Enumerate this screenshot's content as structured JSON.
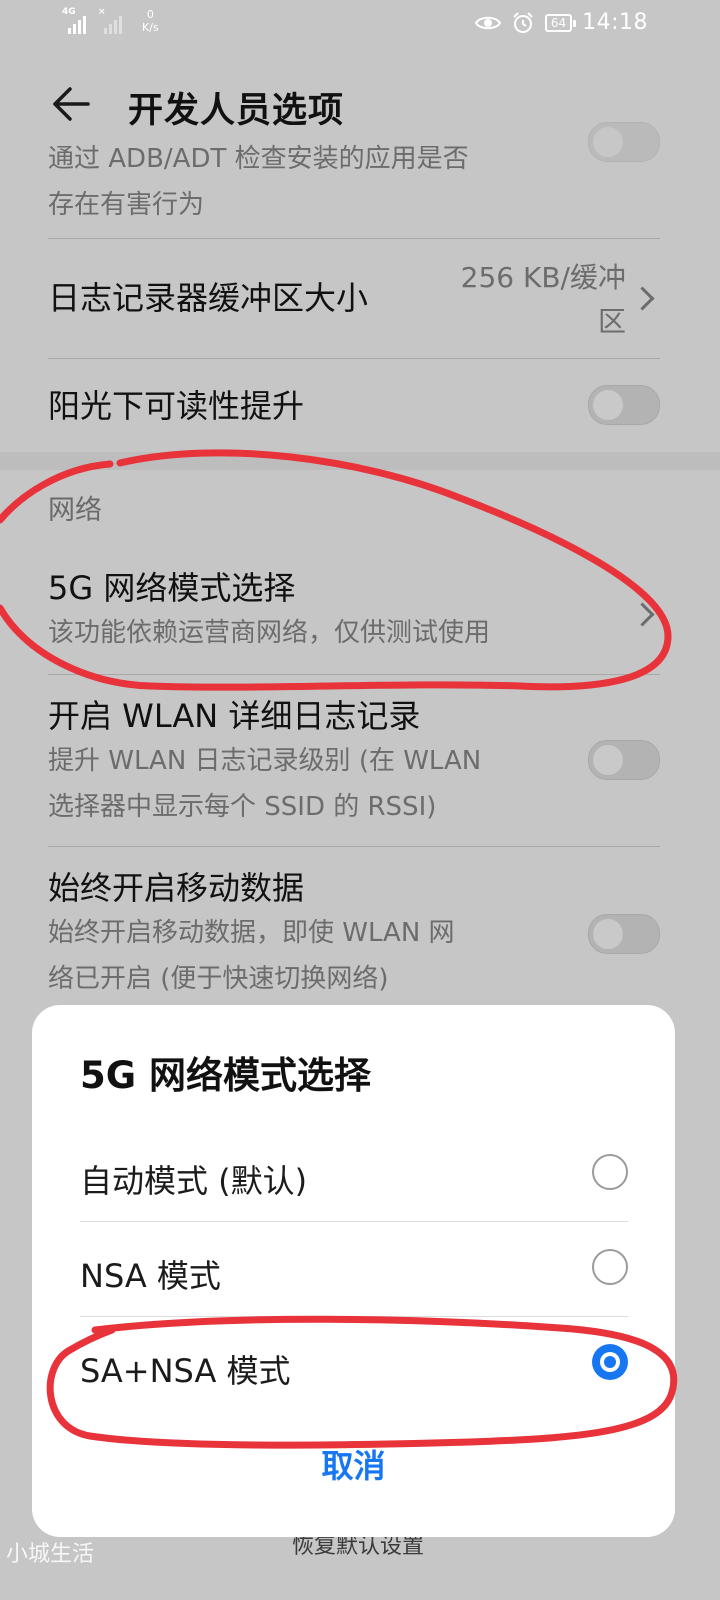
{
  "status_bar": {
    "signal1_tag": "4G",
    "signal2_tag": "×",
    "speed_value": "0",
    "speed_unit": "K/s",
    "battery": "64",
    "time": "14:18",
    "icons": [
      "eye-icon",
      "alarm-icon"
    ]
  },
  "header": {
    "title": "开发人员选项",
    "back_icon": "arrow-left-icon"
  },
  "settings": {
    "adb_check_sub_line1": "通过 ADB/ADT 检查安装的应用是否",
    "adb_check_sub_line2": "存在有害行为",
    "log_buffer_title": "日志记录器缓冲区大小",
    "log_buffer_value_line1": "256 KB/缓冲",
    "log_buffer_value_line2": "区",
    "sunlight_title": "阳光下可读性提升",
    "network_section": "网络",
    "fiveg_title": "5G 网络模式选择",
    "fiveg_sub": "该功能依赖运营商网络，仅供测试使用",
    "wlan_log_title": "开启 WLAN 详细日志记录",
    "wlan_log_sub_line1": "提升 WLAN 日志记录级别 (在 WLAN",
    "wlan_log_sub_line2": "选择器中显示每个 SSID 的 RSSI)",
    "mobile_data_title": "始终开启移动数据",
    "mobile_data_sub_line1": "始终开启移动数据，即使 WLAN 网",
    "mobile_data_sub_line2": "络已开启 (便于快速切换网络)"
  },
  "dialog": {
    "title": "5G 网络模式选择",
    "options": [
      {
        "label": "自动模式 (默认)",
        "checked": false
      },
      {
        "label": "NSA 模式",
        "checked": false
      },
      {
        "label": "SA+NSA 模式",
        "checked": true
      }
    ],
    "cancel_label": "取消"
  },
  "background_bottom": "恢复默认设置",
  "watermark": "小城生活",
  "colors": {
    "accent": "#1777f2",
    "annotation": "#e8333b",
    "dim_background": "#c6c6c6"
  }
}
